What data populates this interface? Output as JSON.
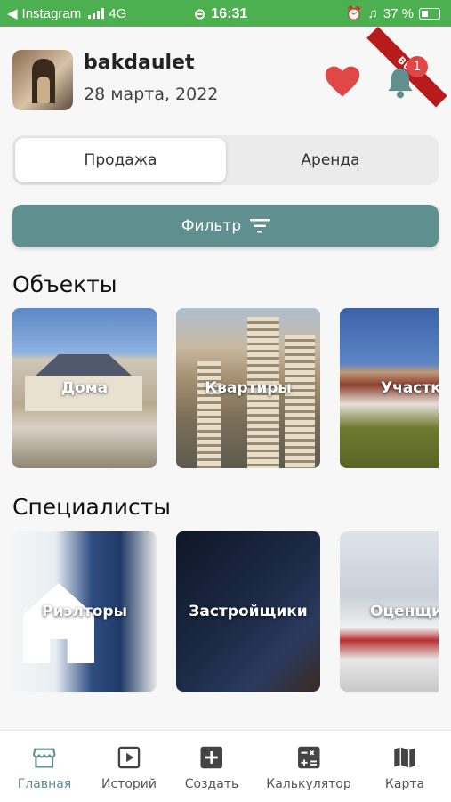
{
  "status_bar": {
    "carrier": "Instagram",
    "network": "4G",
    "time": "16:31",
    "battery": "37 %"
  },
  "debug_banner": "BUG",
  "profile": {
    "username": "bakdaulet",
    "date": "28 марта, 2022"
  },
  "notifications": {
    "count": "1"
  },
  "segmented": {
    "selected_index": 0,
    "options": [
      "Продажа",
      "Аренда"
    ]
  },
  "filter_button": {
    "label": "Фильтр"
  },
  "sections": {
    "objects": {
      "title": "Объекты",
      "cards": [
        "Дома",
        "Квартиры",
        "Участки"
      ]
    },
    "specialists": {
      "title": "Специалисты",
      "cards": [
        "Риэлторы",
        "Застройщики",
        "Оценщики"
      ]
    }
  },
  "tab_bar": {
    "active_index": 0,
    "items": [
      {
        "label": "Главная",
        "icon": "store-icon"
      },
      {
        "label": "Историй",
        "icon": "play-icon"
      },
      {
        "label": "Создать",
        "icon": "plus-icon"
      },
      {
        "label": "Калькулятор",
        "icon": "calculator-icon"
      },
      {
        "label": "Карта",
        "icon": "map-icon"
      }
    ]
  },
  "colors": {
    "status_bar": "#4caf50",
    "accent": "#5f8f8f",
    "heart": "#e04848",
    "bell": "#5f8f8f",
    "badge": "#e04848"
  }
}
